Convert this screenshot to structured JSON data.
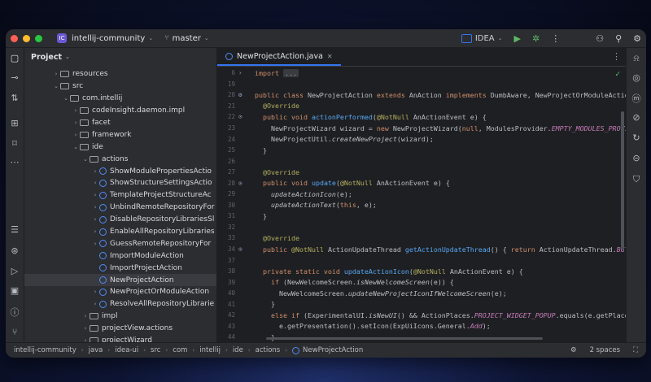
{
  "titlebar": {
    "project_badge": "IC",
    "project": "intellij-community",
    "branch": "master",
    "run_config": "IDEA"
  },
  "project_panel": {
    "title": "Project",
    "tree": [
      {
        "label": "resources",
        "indent": 3,
        "type": "folder",
        "arrow": "›"
      },
      {
        "label": "src",
        "indent": 3,
        "type": "folder",
        "arrow": "⌄"
      },
      {
        "label": "com.intellij",
        "indent": 4,
        "type": "folder",
        "arrow": "⌄"
      },
      {
        "label": "codeInsight.daemon.impl",
        "indent": 5,
        "type": "folder",
        "arrow": "›"
      },
      {
        "label": "facet",
        "indent": 5,
        "type": "folder",
        "arrow": "›"
      },
      {
        "label": "framework",
        "indent": 5,
        "type": "folder",
        "arrow": "›"
      },
      {
        "label": "ide",
        "indent": 5,
        "type": "folder",
        "arrow": "⌄"
      },
      {
        "label": "actions",
        "indent": 6,
        "type": "folder",
        "arrow": "⌄"
      },
      {
        "label": "ShowModulePropertiesActio",
        "indent": 7,
        "type": "class",
        "arrow": "›"
      },
      {
        "label": "ShowStructureSettingsActio",
        "indent": 7,
        "type": "class",
        "arrow": "›"
      },
      {
        "label": "TemplateProjectStructureAc",
        "indent": 7,
        "type": "class",
        "arrow": "›"
      },
      {
        "label": "UnbindRemoteRepositoryFor",
        "indent": 7,
        "type": "class",
        "arrow": "›"
      },
      {
        "label": "DisableRepositoryLibrariesSl",
        "indent": 7,
        "type": "class",
        "arrow": "›"
      },
      {
        "label": "EnableAllRepositoryLibraries",
        "indent": 7,
        "type": "class",
        "arrow": "›"
      },
      {
        "label": "GuessRemoteRepositoryFor",
        "indent": 7,
        "type": "class",
        "arrow": "›"
      },
      {
        "label": "ImportModuleAction",
        "indent": 7,
        "type": "class",
        "arrow": ""
      },
      {
        "label": "ImportProjectAction",
        "indent": 7,
        "type": "class",
        "arrow": ""
      },
      {
        "label": "NewProjectAction",
        "indent": 7,
        "type": "class",
        "arrow": "",
        "selected": true
      },
      {
        "label": "NewProjectOrModuleAction",
        "indent": 7,
        "type": "class",
        "arrow": "›"
      },
      {
        "label": "ResolveAllRepositoryLibrarie",
        "indent": 7,
        "type": "class",
        "arrow": "›"
      },
      {
        "label": "impl",
        "indent": 6,
        "type": "folder",
        "arrow": "›"
      },
      {
        "label": "projectView.actions",
        "indent": 6,
        "type": "folder",
        "arrow": "›"
      },
      {
        "label": "projectWizard",
        "indent": 6,
        "type": "folder",
        "arrow": "›"
      }
    ]
  },
  "editor": {
    "tab_title": "NewProjectAction.java",
    "lines": [
      {
        "n": "6",
        "g": "›",
        "html": "<span class=\"kw\">import</span> <span class=\"fold\">...</span>"
      },
      {
        "n": "19",
        "g": "",
        "html": ""
      },
      {
        "n": "20",
        "g": "⚙",
        "html": "<span class=\"kw\">public class</span> NewProjectAction <span class=\"kw\">extends</span> AnAction <span class=\"kw\">implements</span> DumbAware, NewProjectOrModuleAction {"
      },
      {
        "n": "21",
        "g": "",
        "html": "  <span class=\"an\">@Override</span>"
      },
      {
        "n": "22",
        "g": "⊙",
        "html": "  <span class=\"kw\">public void</span> <span class=\"fn\">actionPerformed</span>(<span class=\"an\">@NotNull</span> AnActionEvent e) {"
      },
      {
        "n": "23",
        "g": "",
        "html": "    NewProjectWizard wizard = <span class=\"kw\">new</span> NewProjectWizard(<span class=\"kw\">null</span>, ModulesProvider.<span class=\"cn\">EMPTY_MODULES_PROVIDER</span>, <span class=\"kw\">null</span>);"
      },
      {
        "n": "24",
        "g": "",
        "html": "    NewProjectUtil.<span class=\"it\">createNewProject</span>(wizard);"
      },
      {
        "n": "25",
        "g": "",
        "html": "  }"
      },
      {
        "n": "26",
        "g": "",
        "html": ""
      },
      {
        "n": "27",
        "g": "",
        "html": "  <span class=\"an\">@Override</span>"
      },
      {
        "n": "28",
        "g": "⊙",
        "html": "  <span class=\"kw\">public void</span> <span class=\"fn\">update</span>(<span class=\"an\">@NotNull</span> AnActionEvent e) {"
      },
      {
        "n": "29",
        "g": "",
        "html": "    <span class=\"it\">updateActionIcon</span>(e);"
      },
      {
        "n": "30",
        "g": "",
        "html": "    <span class=\"it\">updateActionText</span>(<span class=\"kw\">this</span>, e);"
      },
      {
        "n": "31",
        "g": "",
        "html": "  }"
      },
      {
        "n": "32",
        "g": "",
        "html": ""
      },
      {
        "n": "33",
        "g": "",
        "html": "  <span class=\"an\">@Override</span>"
      },
      {
        "n": "34",
        "g": "⊙",
        "html": "  <span class=\"kw\">public</span> <span class=\"an\">@NotNull</span> ActionUpdateThread <span class=\"fn\">getActionUpdateThread</span>() { <span class=\"kw\">return</span> ActionUpdateThread.<span class=\"cn\">BGT</span>; }"
      },
      {
        "n": "37",
        "g": "",
        "html": ""
      },
      {
        "n": "38",
        "g": "",
        "html": "  <span class=\"kw\">private static void</span> <span class=\"fn\">updateActionIcon</span>(<span class=\"an\">@NotNull</span> AnActionEvent e) {"
      },
      {
        "n": "39",
        "g": "",
        "html": "    <span class=\"kw\">if</span> (NewWelcomeScreen.<span class=\"it\">isNewWelcomeScreen</span>(e)) {"
      },
      {
        "n": "40",
        "g": "",
        "html": "      NewWelcomeScreen.<span class=\"it\">updateNewProjectIconIfWelcomeScreen</span>(e);"
      },
      {
        "n": "41",
        "g": "",
        "html": "    }"
      },
      {
        "n": "42",
        "g": "",
        "html": "    <span class=\"kw\">else if</span> (ExperimentalUI.<span class=\"it\">isNewUI</span>() &amp;&amp; ActionPlaces.<span class=\"cn\">PROJECT_WIDGET_POPUP</span>.equals(e.getPlace())) {"
      },
      {
        "n": "43",
        "g": "",
        "html": "      e.getPresentation().setIcon(ExpUiIcons.General.<span class=\"cn\">Add</span>);"
      },
      {
        "n": "44",
        "g": "",
        "html": "    }"
      }
    ]
  },
  "status": {
    "crumbs": [
      "intellij-community",
      "java",
      "idea-ui",
      "src",
      "com",
      "intellij",
      "ide",
      "actions",
      "NewProjectAction"
    ],
    "indent": "2 spaces"
  }
}
